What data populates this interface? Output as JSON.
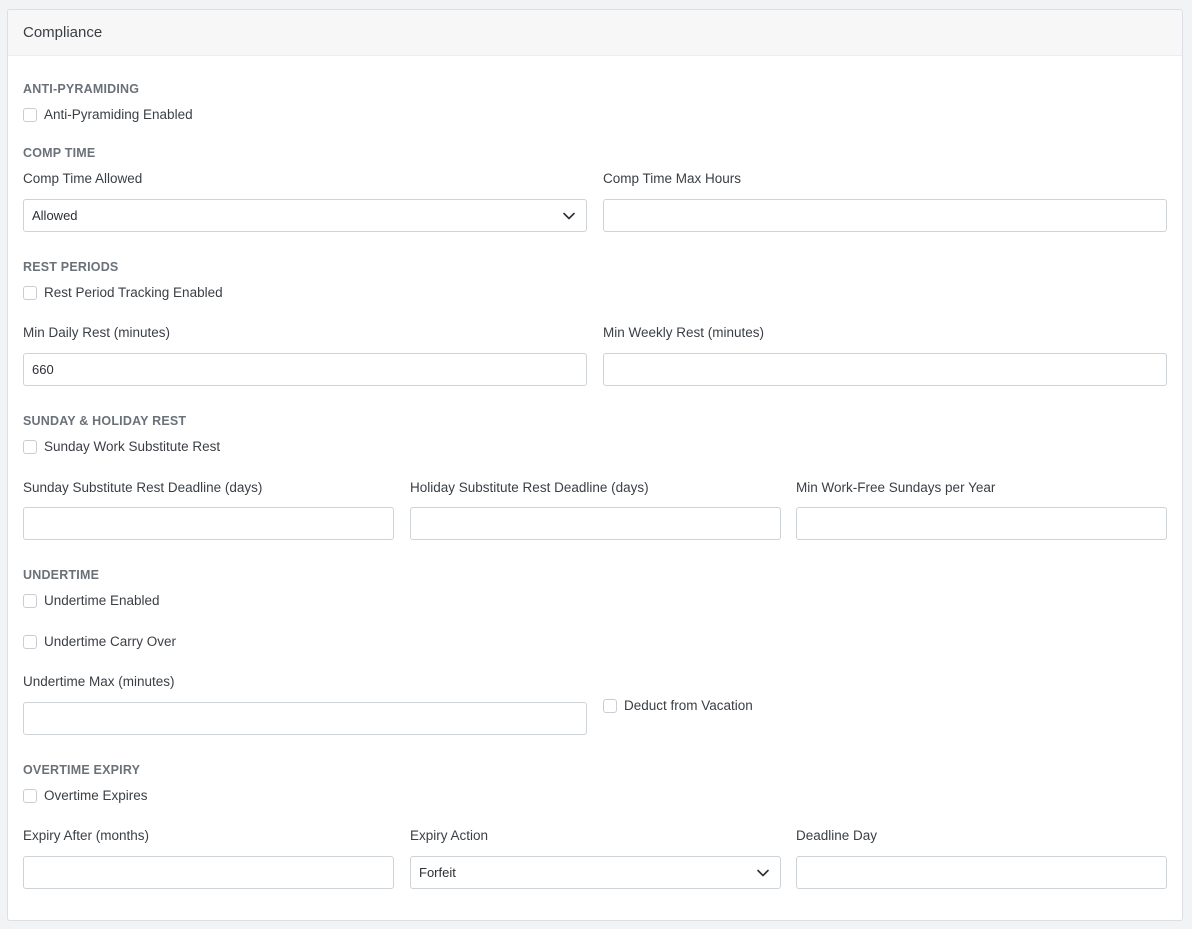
{
  "panel": {
    "title": "Compliance"
  },
  "anti_pyramiding": {
    "title": "ANTI-PYRAMIDING",
    "enabled_label": "Anti-Pyramiding Enabled",
    "enabled": false
  },
  "comp_time": {
    "title": "COMP TIME",
    "allowed_label": "Comp Time Allowed",
    "allowed_value": "Allowed",
    "max_hours_label": "Comp Time Max Hours",
    "max_hours_value": ""
  },
  "rest_periods": {
    "title": "REST PERIODS",
    "tracking_label": "Rest Period Tracking Enabled",
    "tracking": false,
    "min_daily_label": "Min Daily Rest (minutes)",
    "min_daily_value": "660",
    "min_weekly_label": "Min Weekly Rest (minutes)",
    "min_weekly_value": ""
  },
  "sunday_holiday": {
    "title": "SUNDAY & HOLIDAY REST",
    "substitute_label": "Sunday Work Substitute Rest",
    "substitute": false,
    "sunday_deadline_label": "Sunday Substitute Rest Deadline (days)",
    "sunday_deadline_value": "",
    "holiday_deadline_label": "Holiday Substitute Rest Deadline (days)",
    "holiday_deadline_value": "",
    "min_sundays_label": "Min Work-Free Sundays per Year",
    "min_sundays_value": ""
  },
  "undertime": {
    "title": "UNDERTIME",
    "enabled_label": "Undertime Enabled",
    "enabled": false,
    "carry_over_label": "Undertime Carry Over",
    "carry_over": false,
    "max_label": "Undertime Max (minutes)",
    "max_value": "",
    "deduct_label": "Deduct from Vacation",
    "deduct": false
  },
  "overtime_expiry": {
    "title": "OVERTIME EXPIRY",
    "expires_label": "Overtime Expires",
    "expires": false,
    "after_label": "Expiry After (months)",
    "after_value": "",
    "action_label": "Expiry Action",
    "action_value": "Forfeit",
    "deadline_day_label": "Deadline Day",
    "deadline_day_value": ""
  },
  "icons": {
    "dropdown": "chevron-down-icon"
  }
}
